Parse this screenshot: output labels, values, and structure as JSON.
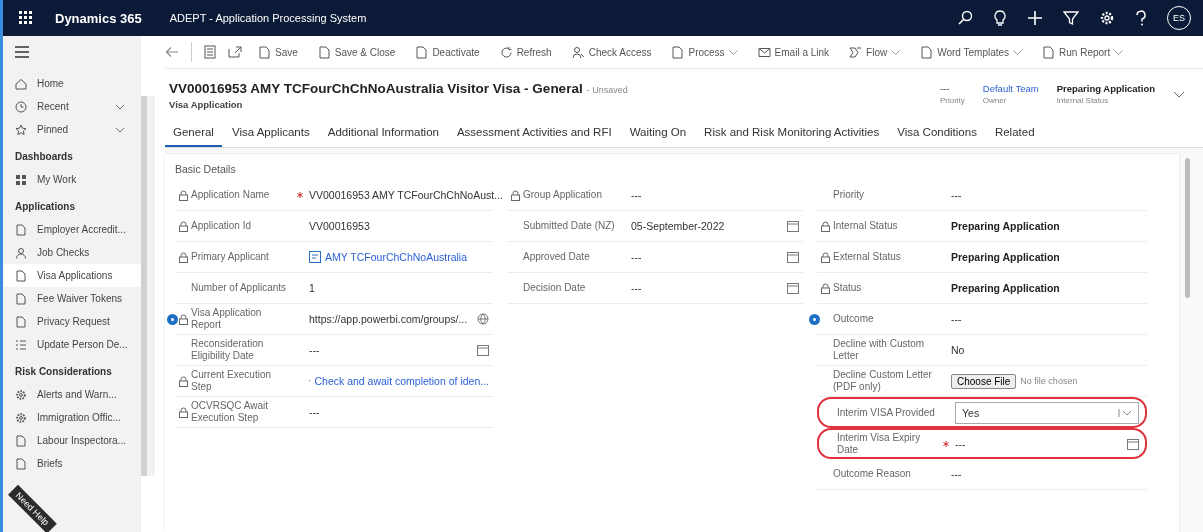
{
  "topbar": {
    "app_name": "Dynamics 365",
    "system_name": "ADEPT - Application Processing System",
    "user_initials": "ES"
  },
  "sidebar": {
    "items": [
      {
        "kind": "nav",
        "label": "Home",
        "chevron": false,
        "selected": false
      },
      {
        "kind": "nav",
        "label": "Recent",
        "chevron": true,
        "selected": false
      },
      {
        "kind": "nav",
        "label": "Pinned",
        "chevron": true,
        "selected": false
      },
      {
        "kind": "heading",
        "label": "Dashboards"
      },
      {
        "kind": "nav",
        "label": "My Work",
        "chevron": false,
        "selected": false
      },
      {
        "kind": "heading",
        "label": "Applications"
      },
      {
        "kind": "nav",
        "label": "Employer Accredit...",
        "chevron": false,
        "selected": false
      },
      {
        "kind": "nav",
        "label": "Job Checks",
        "chevron": false,
        "selected": false
      },
      {
        "kind": "nav",
        "label": "Visa Applications",
        "chevron": false,
        "selected": true
      },
      {
        "kind": "nav",
        "label": "Fee Waiver Tokens",
        "chevron": false,
        "selected": false
      },
      {
        "kind": "nav",
        "label": "Privacy Request",
        "chevron": false,
        "selected": false
      },
      {
        "kind": "nav",
        "label": "Update Person De...",
        "chevron": false,
        "selected": false
      },
      {
        "kind": "heading",
        "label": "Risk Considerations"
      },
      {
        "kind": "nav",
        "label": "Alerts and Warn...",
        "chevron": false,
        "selected": false
      },
      {
        "kind": "nav",
        "label": "Immigration Offic...",
        "chevron": false,
        "selected": false
      },
      {
        "kind": "nav",
        "label": "Labour Inspectora...",
        "chevron": false,
        "selected": false
      },
      {
        "kind": "nav",
        "label": "Briefs",
        "chevron": false,
        "selected": false
      }
    ],
    "help_label": "Need Help"
  },
  "toolbar": [
    {
      "label": "Save",
      "chevron": false
    },
    {
      "label": "Save & Close",
      "chevron": false
    },
    {
      "label": "Deactivate",
      "chevron": false
    },
    {
      "label": "Refresh",
      "chevron": false
    },
    {
      "label": "Check Access",
      "chevron": false
    },
    {
      "label": "Process",
      "chevron": true
    },
    {
      "label": "Email a Link",
      "chevron": false
    },
    {
      "label": "Flow",
      "chevron": true
    },
    {
      "label": "Word Templates",
      "chevron": true
    },
    {
      "label": "Run Report",
      "chevron": true
    }
  ],
  "header": {
    "title": "VV00016953 AMY TCFourChChNoAustralia Visitor Visa - General",
    "save_state": "- Unsaved",
    "entity": "Visa Application",
    "fields": [
      {
        "value": "---",
        "label": "Priority",
        "kind": "text"
      },
      {
        "value": "Default Team",
        "label": "Owner",
        "kind": "link"
      },
      {
        "value": "Preparing Application",
        "label": "Internal Status",
        "kind": "bold"
      }
    ]
  },
  "tabs": [
    {
      "label": "General",
      "selected": true
    },
    {
      "label": "Visa Applicants",
      "selected": false
    },
    {
      "label": "Additional Information",
      "selected": false
    },
    {
      "label": "Assessment Activities and RFI",
      "selected": false
    },
    {
      "label": "Waiting On",
      "selected": false
    },
    {
      "label": "Risk and Risk Monitoring Activities",
      "selected": false
    },
    {
      "label": "Visa Conditions",
      "selected": false
    },
    {
      "label": "Related",
      "selected": false
    }
  ],
  "section_title": "Basic Details",
  "columns": [
    [
      {
        "label": "Application Name",
        "value": "VV00016953 AMY TCFourChChNoAust...",
        "kind": "text",
        "locked": true,
        "required": true,
        "info": false,
        "highlighted": false
      },
      {
        "label": "Application Id",
        "value": "VV00016953",
        "kind": "text",
        "locked": true,
        "required": false,
        "info": false,
        "highlighted": false
      },
      {
        "label": "Primary Applicant",
        "value": "AMY TCFourChChNoAustralia",
        "kind": "link",
        "locked": true,
        "required": false,
        "info": false,
        "highlighted": false
      },
      {
        "label": "Number of Applicants",
        "value": "1",
        "kind": "text",
        "locked": false,
        "required": false,
        "info": false,
        "highlighted": false
      },
      {
        "label": "Visa Application Report",
        "value": "https://app.powerbi.com/groups/...",
        "kind": "url",
        "locked": true,
        "required": false,
        "info": true,
        "highlighted": false
      },
      {
        "label": "Reconsideration Eligibility Date",
        "value": "---",
        "kind": "date",
        "locked": false,
        "required": false,
        "info": false,
        "highlighted": false
      },
      {
        "label": "Current Execution Step",
        "value": "Check and await completion of iden...",
        "kind": "link",
        "locked": true,
        "required": false,
        "info": false,
        "highlighted": false
      },
      {
        "label": "OCVRSQC Await Execution Step",
        "value": "---",
        "kind": "text",
        "locked": true,
        "required": false,
        "info": false,
        "highlighted": false
      }
    ],
    [
      {
        "label": "Group Application",
        "value": "---",
        "kind": "text",
        "locked": true,
        "required": false,
        "info": false,
        "highlighted": false
      },
      {
        "label": "Submitted Date (NZ)",
        "value": "05-September-2022",
        "kind": "date",
        "locked": false,
        "required": false,
        "info": false,
        "highlighted": false
      },
      {
        "label": "Approved Date",
        "value": "---",
        "kind": "date",
        "locked": false,
        "required": false,
        "info": false,
        "highlighted": false
      },
      {
        "label": "Decision Date",
        "value": "---",
        "kind": "date",
        "locked": false,
        "required": false,
        "info": false,
        "highlighted": false
      }
    ],
    [
      {
        "label": "Priority",
        "value": "---",
        "kind": "text",
        "locked": false,
        "required": false,
        "info": false,
        "highlighted": false
      },
      {
        "label": "Internal Status",
        "value": "Preparing Application",
        "kind": "bold",
        "locked": true,
        "required": false,
        "info": false,
        "highlighted": false
      },
      {
        "label": "External Status",
        "value": "Preparing Application",
        "kind": "bold",
        "locked": true,
        "required": false,
        "info": false,
        "highlighted": false
      },
      {
        "label": "Status",
        "value": "Preparing Application",
        "kind": "bold",
        "locked": true,
        "required": false,
        "info": false,
        "highlighted": false
      },
      {
        "label": "Outcome",
        "value": "---",
        "kind": "text",
        "locked": false,
        "required": false,
        "info": true,
        "highlighted": false
      },
      {
        "label": "Decline with Custom Letter",
        "value": "No",
        "kind": "text",
        "locked": false,
        "required": false,
        "info": false,
        "highlighted": false
      },
      {
        "label": "Decline Custom Letter (PDF only)",
        "value": "Choose File",
        "note": "No file chosen",
        "kind": "file",
        "locked": false,
        "required": false,
        "info": false,
        "highlighted": false
      },
      {
        "label": "Interim VISA Provided",
        "value": "Yes",
        "kind": "select",
        "locked": false,
        "required": false,
        "info": false,
        "highlighted": true
      },
      {
        "label": "Interim Visa Expiry Date",
        "value": "---",
        "kind": "date",
        "locked": false,
        "required": true,
        "info": false,
        "highlighted": true
      },
      {
        "label": "Outcome Reason",
        "value": "---",
        "kind": "text",
        "locked": false,
        "required": false,
        "info": false,
        "highlighted": false
      }
    ]
  ]
}
